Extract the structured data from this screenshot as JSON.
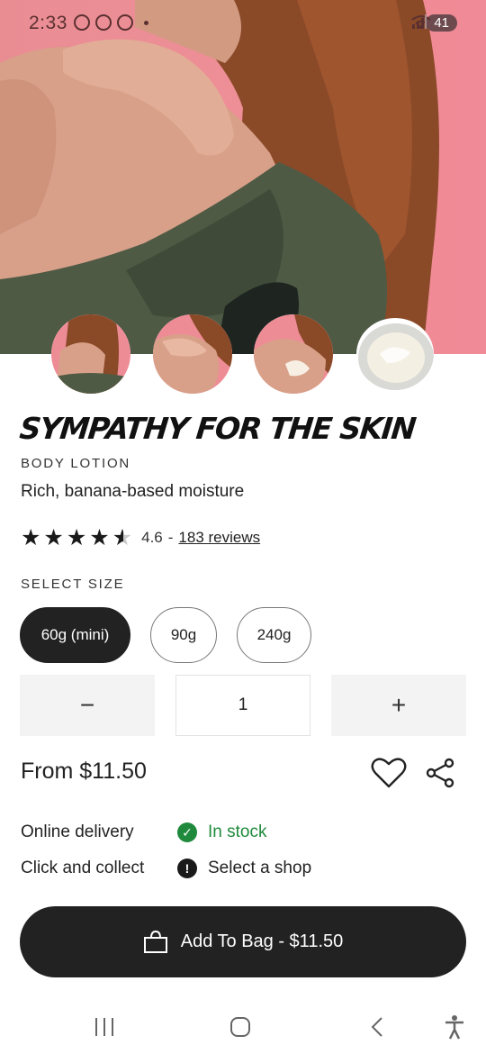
{
  "status_bar": {
    "time": "2:33",
    "battery": "41"
  },
  "product": {
    "title": "SYMPATHY FOR THE SKIN",
    "category": "BODY LOTION",
    "tagline": "Rich, banana-based moisture",
    "rating_value": "4.6",
    "rating_separator": "-",
    "reviews_label": "183 reviews",
    "stars_filled": 4.6,
    "stars_total": 5
  },
  "gallery": {
    "thumbnails": [
      "thumbnail-model-shoulder",
      "thumbnail-hand-on-shoulder",
      "thumbnail-lotion-on-shoulder",
      "thumbnail-lotion-pot"
    ]
  },
  "size": {
    "label": "SELECT SIZE",
    "options": [
      "60g (mini)",
      "90g",
      "240g"
    ],
    "selected": "60g (mini)"
  },
  "quantity": {
    "decrement_label": "−",
    "value": "1",
    "increment_label": "+"
  },
  "price": {
    "label": "From $11.50"
  },
  "availability": {
    "online_label": "Online delivery",
    "online_status": "In stock",
    "collect_label": "Click and collect",
    "collect_status": "Select a shop"
  },
  "cta": {
    "label": "Add To Bag - $11.50"
  },
  "colors": {
    "hero_pink": "#ef8e98",
    "dark": "#222222",
    "in_stock_green": "#1f8a3c"
  },
  "icons": {
    "favorite": "heart-icon",
    "share": "share-icon",
    "bag": "shopping-bag-icon",
    "in_stock": "check-circle-icon",
    "select_shop": "exclamation-circle-icon"
  }
}
